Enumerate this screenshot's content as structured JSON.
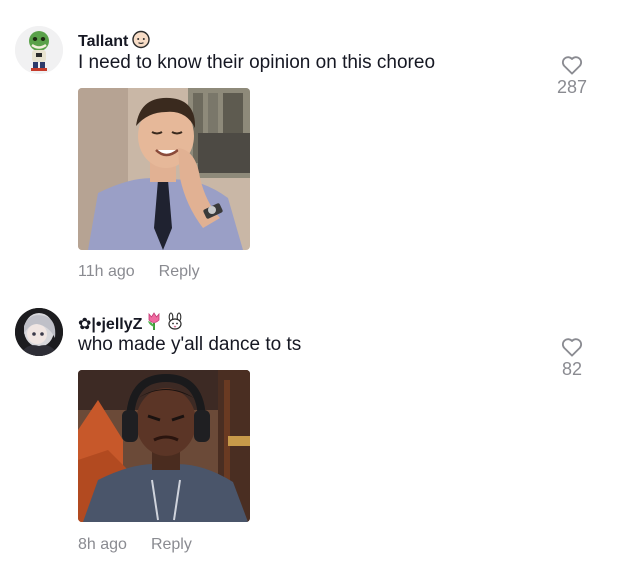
{
  "comments": [
    {
      "username": "Tallant",
      "text": "I need to know their opinion on this choreo",
      "time": "11h ago",
      "reply_label": "Reply",
      "likes": "287",
      "avatar_icon": "green-mask-character-avatar",
      "badge_icon": "bald-face-emoji",
      "media": "man-laughing-in-office-gif"
    },
    {
      "username": "✿|•jellyZ",
      "text": "who made y'all dance to ts",
      "time": "8h ago",
      "reply_label": "Reply",
      "likes": "82",
      "avatar_icon": "anime-girl-avatar",
      "badge_icon": "tulip-and-bunny-emoji",
      "media": "man-with-headphones-wincing-gif"
    }
  ],
  "colors": {
    "primary_text": "#161823",
    "secondary_text": "#8a8b91",
    "background": "#ffffff"
  }
}
